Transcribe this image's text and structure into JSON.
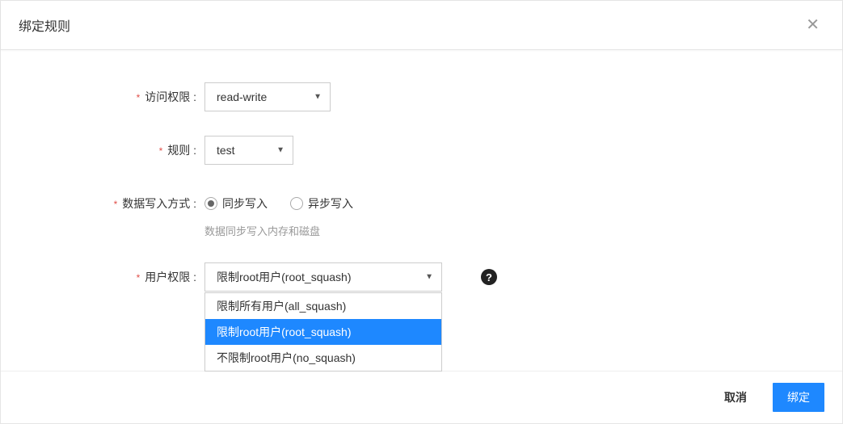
{
  "modal": {
    "title": "绑定规则"
  },
  "form": {
    "access_permission": {
      "label": "访问权限 :",
      "value": "read-write"
    },
    "rule": {
      "label": "规则 :",
      "value": "test"
    },
    "write_mode": {
      "label": "数据写入方式 :",
      "options": {
        "sync": "同步写入",
        "async": "异步写入"
      },
      "help_text": "数据同步写入内存和磁盘"
    },
    "user_permission": {
      "label": "用户权限 :",
      "value": "限制root用户(root_squash)",
      "options": [
        "限制所有用户(all_squash)",
        "限制root用户(root_squash)",
        "不限制root用户(no_squash)"
      ]
    }
  },
  "footer": {
    "cancel": "取消",
    "confirm": "绑定"
  }
}
